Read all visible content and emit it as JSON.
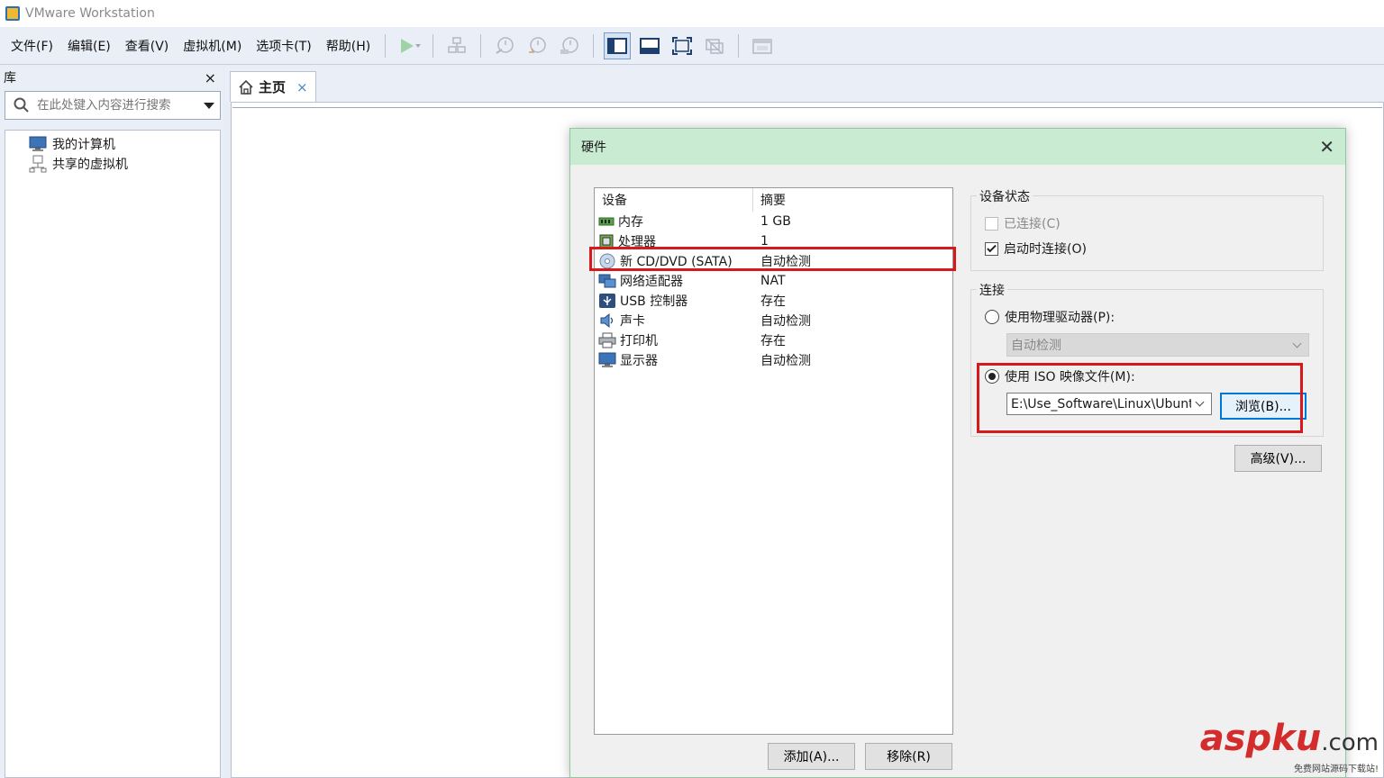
{
  "window": {
    "title": "VMware Workstation"
  },
  "menu": [
    "文件(F)",
    "编辑(E)",
    "查看(V)",
    "虚拟机(M)",
    "选项卡(T)",
    "帮助(H)"
  ],
  "library": {
    "title": "库",
    "close": "×",
    "search_placeholder": "在此处键入内容进行搜索",
    "tree": [
      {
        "label": "我的计算机",
        "icon": "computer-icon"
      },
      {
        "label": "共享的虚拟机",
        "icon": "shared-vm-icon"
      }
    ]
  },
  "tab": {
    "label": "主页",
    "close": "×",
    "icon": "home-icon"
  },
  "dialog": {
    "title": "硬件",
    "close": "✕",
    "columns": [
      "设备",
      "摘要"
    ],
    "devices": [
      {
        "name": "内存",
        "summary": "1 GB",
        "icon": "memory-icon"
      },
      {
        "name": "处理器",
        "summary": "1",
        "icon": "cpu-icon"
      },
      {
        "name": "新 CD/DVD (SATA)",
        "summary": "自动检测",
        "icon": "cd-icon"
      },
      {
        "name": "网络适配器",
        "summary": "NAT",
        "icon": "network-icon"
      },
      {
        "name": "USB 控制器",
        "summary": "存在",
        "icon": "usb-icon"
      },
      {
        "name": "声卡",
        "summary": "自动检测",
        "icon": "sound-icon"
      },
      {
        "name": "打印机",
        "summary": "存在",
        "icon": "printer-icon"
      },
      {
        "name": "显示器",
        "summary": "自动检测",
        "icon": "display-icon"
      }
    ],
    "device_status": {
      "legend": "设备状态",
      "connected": "已连接(C)",
      "connect_on_start": "启动时连接(O)"
    },
    "connection": {
      "legend": "连接",
      "physical": "使用物理驱动器(P):",
      "physical_value": "自动检测",
      "iso": "使用 ISO 映像文件(M):",
      "iso_path": "E:\\Use_Software\\Linux\\Ubuntu",
      "browse": "浏览(B)..."
    },
    "advanced": "高级(V)...",
    "add": "添加(A)...",
    "remove": "移除(R)"
  },
  "watermark": {
    "logo_a": "asp",
    "logo_b": "ku",
    "logo_c": ".com",
    "sub": "免费网站源码下载站!"
  },
  "colors": {
    "highlight": "#d8191c",
    "dialog_title": "#c8ebd2",
    "accent": "#0078d7"
  }
}
